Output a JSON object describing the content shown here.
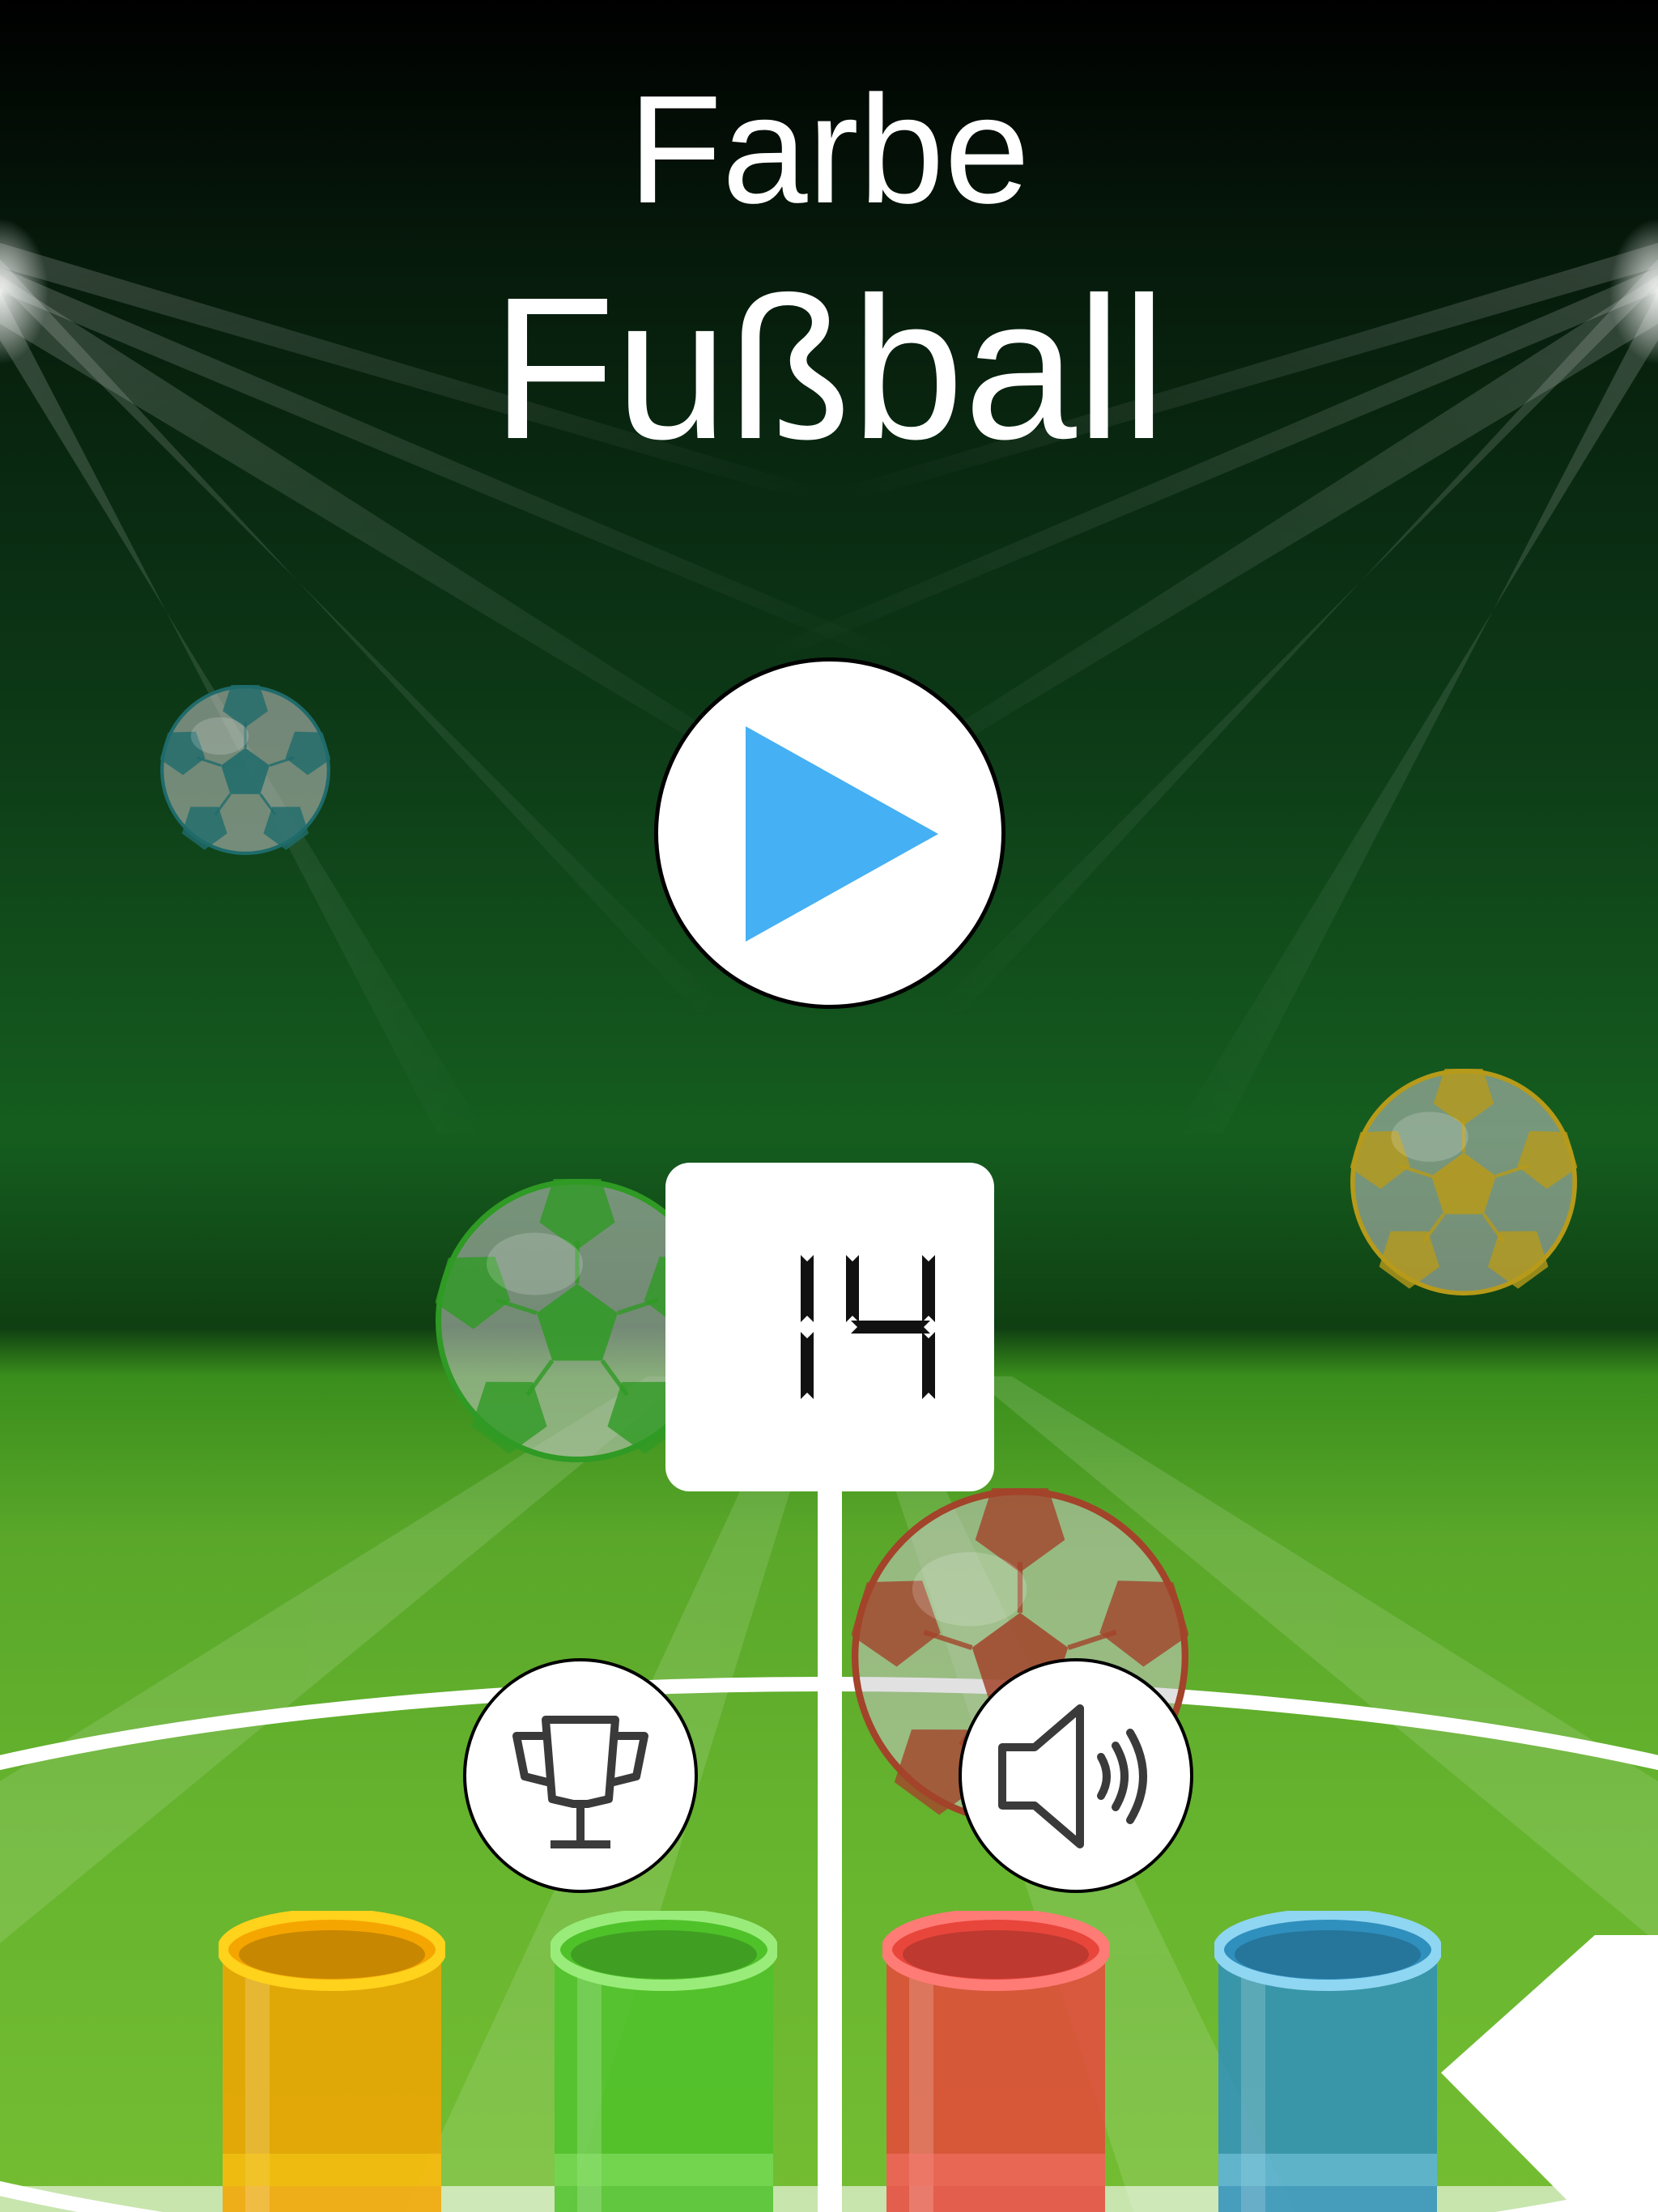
{
  "title": {
    "line1": "Farbe",
    "line2": "Fußball"
  },
  "score": {
    "value": "14"
  },
  "buttons": {
    "play_icon": "play-icon",
    "trophy_icon": "trophy-icon",
    "sound_icon": "speaker-icon"
  },
  "balls": [
    {
      "color": "#1f6b6b"
    },
    {
      "color": "#2f9a24"
    },
    {
      "color": "#b79a1a"
    },
    {
      "color": "#a2432a"
    }
  ],
  "tubes": [
    {
      "color": "#f5a500",
      "rim": "#ffd21c"
    },
    {
      "color": "#4fc22a",
      "rim": "#99ec7a"
    },
    {
      "color": "#e8463b",
      "rim": "#ff7b76"
    },
    {
      "color": "#2f8fbd",
      "rim": "#8fd6f2"
    }
  ],
  "colors": {
    "accent_blue": "#45b0f3"
  }
}
